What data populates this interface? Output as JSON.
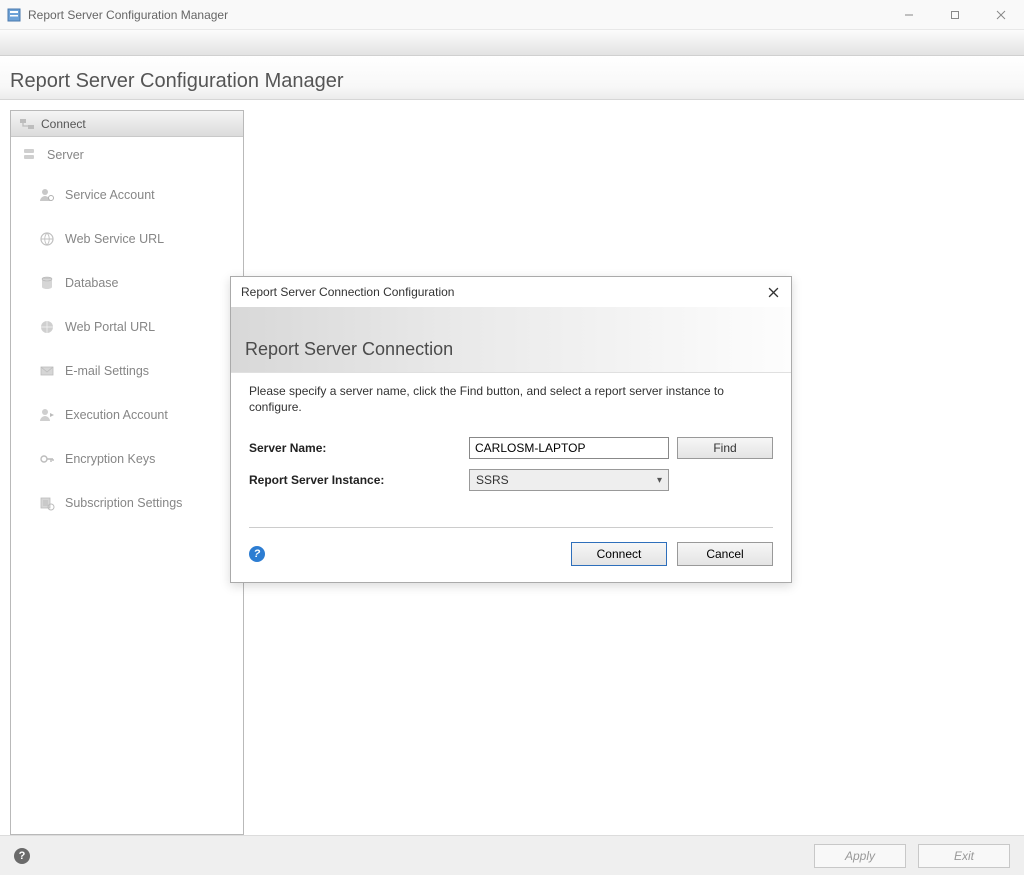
{
  "window": {
    "title": "Report Server Configuration Manager"
  },
  "header": {
    "title": "Report Server Configuration Manager"
  },
  "sidebar": {
    "connect_label": "Connect",
    "root_label": "Server",
    "items": [
      {
        "label": "Service Account",
        "icon": "user-gear-icon"
      },
      {
        "label": "Web Service URL",
        "icon": "globe-link-icon"
      },
      {
        "label": "Database",
        "icon": "database-icon"
      },
      {
        "label": "Web Portal URL",
        "icon": "globe-icon"
      },
      {
        "label": "E-mail Settings",
        "icon": "mail-icon"
      },
      {
        "label": "Execution Account",
        "icon": "account-run-icon"
      },
      {
        "label": "Encryption Keys",
        "icon": "key-icon"
      },
      {
        "label": "Subscription Settings",
        "icon": "subscription-icon"
      }
    ]
  },
  "footer": {
    "apply_label": "Apply",
    "exit_label": "Exit"
  },
  "dialog": {
    "title": "Report Server Connection Configuration",
    "heading": "Report Server Connection",
    "instructions": "Please specify a server name, click the Find button, and select a report server instance to configure.",
    "server_name_label": "Server Name:",
    "server_name_value": "CARLOSM-LAPTOP",
    "instance_label": "Report Server Instance:",
    "instance_value": "SSRS",
    "find_label": "Find",
    "connect_label": "Connect",
    "cancel_label": "Cancel"
  }
}
